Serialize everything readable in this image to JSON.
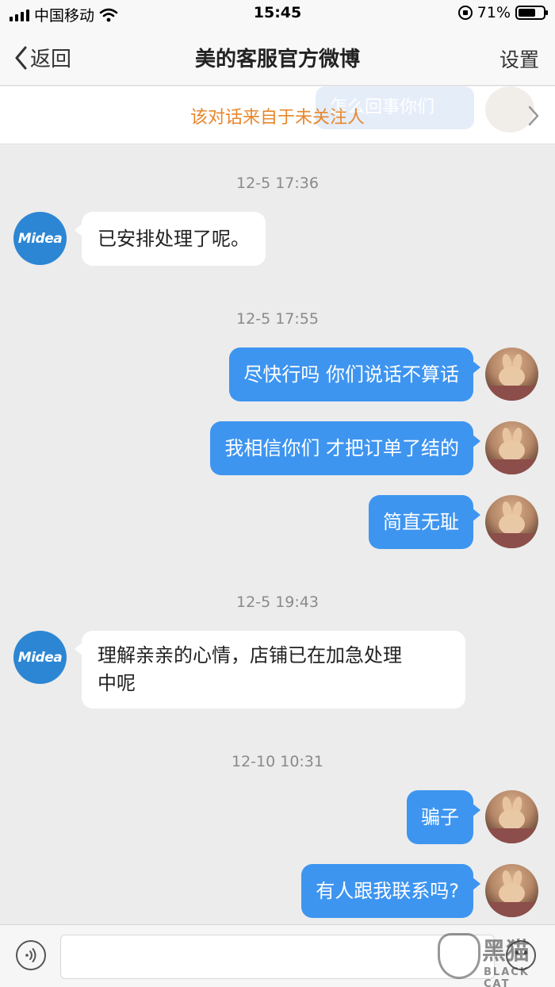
{
  "status": {
    "carrier": "中国移动",
    "time": "15:45",
    "battery": "71%",
    "battery_level": 0.71
  },
  "nav": {
    "back_label": "返回",
    "title": "美的客服官方微博",
    "settings_label": "设置"
  },
  "banner": {
    "text": "该对话来自于未关注人",
    "ghost_text": "怎么回事你们"
  },
  "messages": [
    {
      "time": "12-5 17:36"
    },
    {
      "from": "service",
      "text": "已安排处理了呢。"
    },
    {
      "time": "12-5 17:55"
    },
    {
      "from": "user",
      "text": "尽快行吗  你们说话不算话"
    },
    {
      "from": "user",
      "text": "我相信你们  才把订单了结的"
    },
    {
      "from": "user",
      "text": "简直无耻"
    },
    {
      "time": "12-5 19:43"
    },
    {
      "from": "service",
      "text_line1": "理解亲亲的心情，店铺已在加急处理",
      "text_line2": "中呢"
    },
    {
      "time": "12-10 10:31"
    },
    {
      "from": "user",
      "text": "骗子"
    },
    {
      "from": "user",
      "text": "有人跟我联系吗?"
    }
  ],
  "service_avatar_text": "Midea",
  "watermark": {
    "big": "黑猫",
    "small": "BLACK CAT"
  },
  "colors": {
    "outgoing_bubble": "#3e95f0",
    "banner_text": "#e8872c",
    "midea_blue": "#2c86d3"
  }
}
